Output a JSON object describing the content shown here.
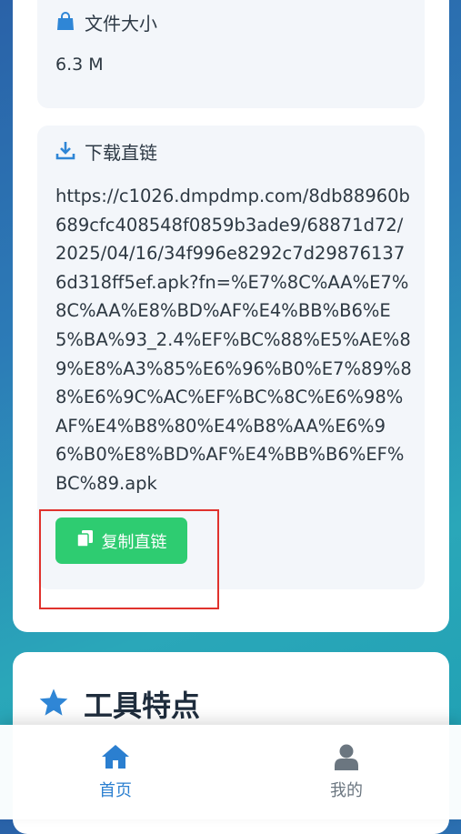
{
  "file_size": {
    "label": "文件大小",
    "value": "6.3 M",
    "icon": "shopping-bag-icon"
  },
  "download": {
    "label": "下载直链",
    "icon": "download-icon",
    "url": "https://c1026.dmpdmp.com/8db88960b689cfc408548f0859b3ade9/68871d72/2025/04/16/34f996e8292c7d298761376d318ff5ef.apk?fn=%E7%8C%AA%E7%8C%AA%E8%BD%AF%E4%BB%B6%E5%BA%93_2.4%EF%BC%88%E5%AE%89%E8%A3%85%E6%96%B0%E7%89%88%E6%9C%AC%EF%BC%8C%E6%98%AF%E4%B8%80%E4%B8%AA%E6%96%B0%E8%BD%AF%E4%BB%B6%EF%BC%89.apk",
    "copy_button_label": "复制直链",
    "copy_icon": "copy-icon"
  },
  "features": {
    "title": "工具特点",
    "icon": "star-icon"
  },
  "tabbar": {
    "items": [
      {
        "label": "首页",
        "icon": "home-icon",
        "active": true
      },
      {
        "label": "我的",
        "icon": "user-icon",
        "active": false
      }
    ]
  },
  "colors": {
    "accent": "#2b7fd0",
    "button_green": "#2ecc71",
    "highlight_red": "#e0322d"
  }
}
